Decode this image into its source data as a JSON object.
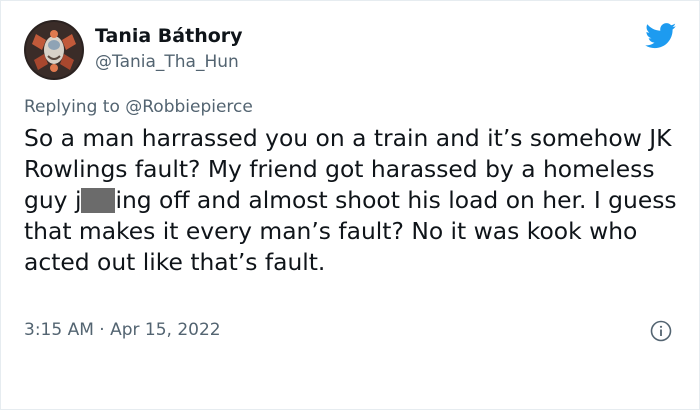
{
  "author": {
    "name": "Tania Báthory",
    "handle": "@Tania_Tha_Hun"
  },
  "reply": {
    "prefix": "Replying to",
    "mention": "@Robbiepierce"
  },
  "tweet": {
    "text_part1": "So a man harrassed you on a train and it’s somehow JK Rowlings fault?  My friend got harassed by a homeless guy j",
    "text_part2": "ing off and almost shoot his load on her.  I guess that makes it every man’s fault? No it was kook who acted out like that’s fault."
  },
  "meta": {
    "time": "3:15 AM",
    "separator": " · ",
    "date": "Apr 15, 2022"
  },
  "icons": {
    "brand": "twitter-bird-icon",
    "info": "info-icon"
  },
  "colors": {
    "brand": "#1d9bf0",
    "secondary_text": "#536471",
    "primary_text": "#0f1419",
    "redaction": "#6b6b6b"
  }
}
